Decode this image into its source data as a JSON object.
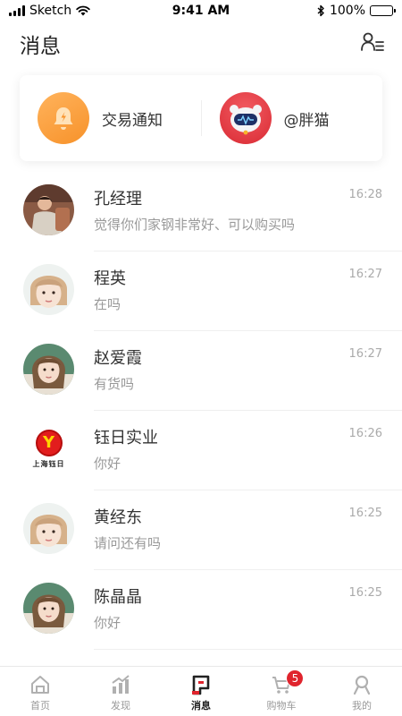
{
  "status_bar": {
    "carrier": "Sketch",
    "time": "9:41 AM",
    "battery": "100%",
    "battery_level": 1.0
  },
  "header": {
    "title": "消息",
    "contacts_icon": "contacts-list-icon"
  },
  "notifications": [
    {
      "label": "交易通知",
      "icon": "bell-icon",
      "color": "#f7922a"
    },
    {
      "label": "@胖猫",
      "icon": "panda-mascot-icon",
      "color": "#d92a33"
    }
  ],
  "conversations": [
    {
      "name": "孔经理",
      "message": "觉得你们家钢非常好、可以购买吗",
      "time": "16:28",
      "avatar": "photo-man"
    },
    {
      "name": "程英",
      "message": "在吗",
      "time": "16:27",
      "avatar": "photo-girl-a"
    },
    {
      "name": "赵爱霞",
      "message": "有货吗",
      "time": "16:27",
      "avatar": "photo-girl-b"
    },
    {
      "name": "钰日实业",
      "message": "你好",
      "time": "16:26",
      "avatar": "logo",
      "logo_letter": "Y",
      "logo_text": "上海钰日"
    },
    {
      "name": "黄经东",
      "message": "请问还有吗",
      "time": "16:25",
      "avatar": "photo-girl-a"
    },
    {
      "name": "陈晶晶",
      "message": "你好",
      "time": "16:25",
      "avatar": "photo-girl-b"
    }
  ],
  "tabs": [
    {
      "label": "首页",
      "icon": "home-icon",
      "active": false
    },
    {
      "label": "发现",
      "icon": "chart-icon",
      "active": false
    },
    {
      "label": "消息",
      "icon": "message-icon",
      "active": true
    },
    {
      "label": "购物车",
      "icon": "cart-icon",
      "active": false,
      "badge": "5"
    },
    {
      "label": "我的",
      "icon": "profile-icon",
      "active": false
    }
  ],
  "colors": {
    "accent": "#e0242d",
    "bell": "#f7922a",
    "panda": "#d92a33",
    "muted_text": "#999999"
  }
}
